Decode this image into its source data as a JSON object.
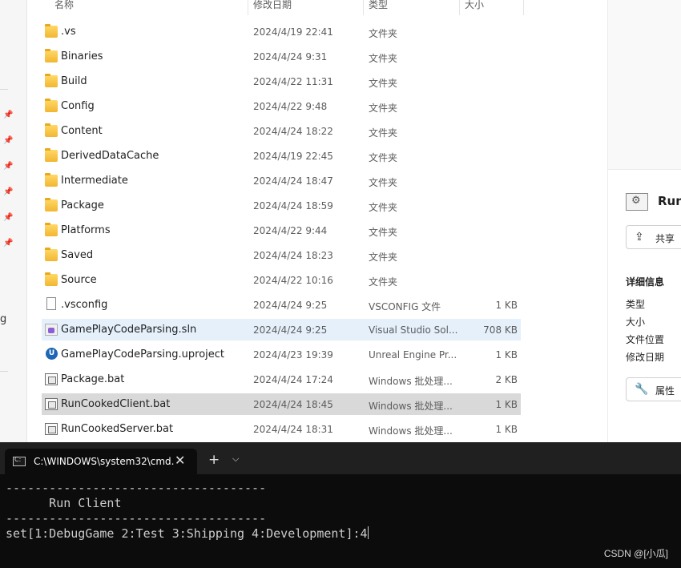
{
  "explorer": {
    "columns": {
      "name": "名称",
      "date": "修改日期",
      "type": "类型",
      "size": "大小"
    },
    "files": [
      {
        "name": ".vs",
        "date": "2024/4/19 22:41",
        "type": "文件夹",
        "size": "",
        "icon": "folder-icon"
      },
      {
        "name": "Binaries",
        "date": "2024/4/24 9:31",
        "type": "文件夹",
        "size": "",
        "icon": "folder-icon"
      },
      {
        "name": "Build",
        "date": "2024/4/22 11:31",
        "type": "文件夹",
        "size": "",
        "icon": "folder-icon"
      },
      {
        "name": "Config",
        "date": "2024/4/22 9:48",
        "type": "文件夹",
        "size": "",
        "icon": "folder-icon"
      },
      {
        "name": "Content",
        "date": "2024/4/24 18:22",
        "type": "文件夹",
        "size": "",
        "icon": "folder-icon"
      },
      {
        "name": "DerivedDataCache",
        "date": "2024/4/19 22:45",
        "type": "文件夹",
        "size": "",
        "icon": "folder-icon"
      },
      {
        "name": "Intermediate",
        "date": "2024/4/24 18:47",
        "type": "文件夹",
        "size": "",
        "icon": "folder-icon"
      },
      {
        "name": "Package",
        "date": "2024/4/24 18:59",
        "type": "文件夹",
        "size": "",
        "icon": "folder-icon"
      },
      {
        "name": "Platforms",
        "date": "2024/4/22 9:44",
        "type": "文件夹",
        "size": "",
        "icon": "folder-icon"
      },
      {
        "name": "Saved",
        "date": "2024/4/24 18:23",
        "type": "文件夹",
        "size": "",
        "icon": "folder-icon"
      },
      {
        "name": "Source",
        "date": "2024/4/22 10:16",
        "type": "文件夹",
        "size": "",
        "icon": "folder-icon"
      },
      {
        "name": ".vsconfig",
        "date": "2024/4/24 9:25",
        "type": "VSCONFIG 文件",
        "size": "1 KB",
        "icon": "file-icon"
      },
      {
        "name": "GamePlayCodeParsing.sln",
        "date": "2024/4/24 9:25",
        "type": "Visual Studio Sol...",
        "size": "708 KB",
        "icon": "sln-icon"
      },
      {
        "name": "GamePlayCodeParsing.uproject",
        "date": "2024/4/23 19:39",
        "type": "Unreal Engine Pr...",
        "size": "1 KB",
        "icon": "unreal-icon"
      },
      {
        "name": "Package.bat",
        "date": "2024/4/24 17:24",
        "type": "Windows 批处理...",
        "size": "2 KB",
        "icon": "bat-icon"
      },
      {
        "name": "RunCookedClient.bat",
        "date": "2024/4/24 18:45",
        "type": "Windows 批处理...",
        "size": "1 KB",
        "icon": "bat-icon"
      },
      {
        "name": "RunCookedServer.bat",
        "date": "2024/4/24 18:31",
        "type": "Windows 批处理...",
        "size": "1 KB",
        "icon": "bat-icon"
      }
    ],
    "left_glyph": "g"
  },
  "details": {
    "title": "Run",
    "share_label": "共享",
    "heading": "详细信息",
    "props": [
      "类型",
      "大小",
      "文件位置",
      "修改日期"
    ],
    "properties_label": "属性"
  },
  "terminal": {
    "tab_title": "C:\\WINDOWS\\system32\\cmd.",
    "lines": [
      "------------------------------------",
      "      Run Client",
      "------------------------------------",
      "set[1:DebugGame 2:Test 3:Shipping 4:Development]:4"
    ],
    "watermark": "CSDN @[小瓜]"
  },
  "colors": {
    "selected_row": "#d9d9d9",
    "hover_row": "#e5f0fb",
    "terminal_bg": "#0c0c0c",
    "terminal_text": "#cccccc"
  }
}
